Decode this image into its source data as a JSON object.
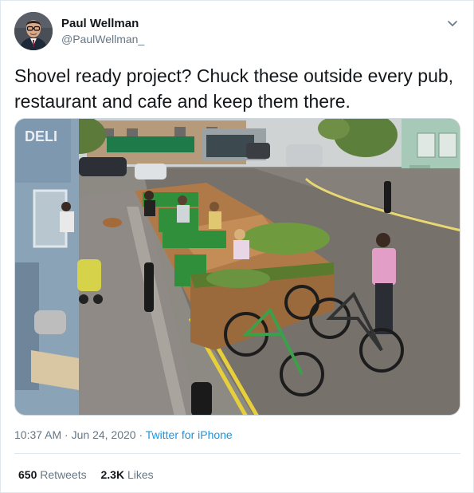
{
  "user": {
    "display_name": "Paul Wellman",
    "handle": "@PaulWellman_"
  },
  "tweet": {
    "text_line1": "Shovel ready project? Chuck these outside every pub,",
    "text_line2": "restaurant and cafe and keep them there.",
    "time": "10:37 AM",
    "separator1": " · ",
    "date": "Jun 24, 2020",
    "separator2": " · ",
    "source": "Twitter for iPhone"
  },
  "media_sign": "DELI",
  "stats": {
    "retweets_count": "650",
    "retweets_label": "Retweets",
    "likes_count": "2.3K",
    "likes_label": "Likes"
  },
  "colors": {
    "link": "#1b95e0",
    "secondary_text": "#657786",
    "primary_text": "#14171a",
    "border": "#e1e8ed"
  },
  "icons": {
    "caret": "chevron-down-icon"
  }
}
